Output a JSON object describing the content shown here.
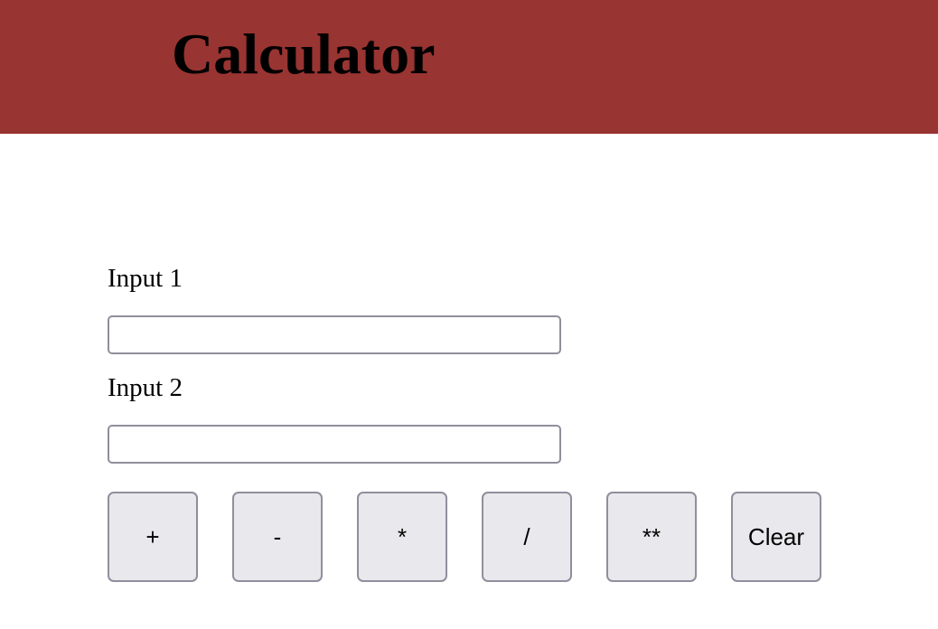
{
  "header": {
    "title": "Calculator",
    "background_color": "#983431"
  },
  "form": {
    "input1": {
      "label": "Input 1",
      "value": "",
      "placeholder": ""
    },
    "input2": {
      "label": "Input 2",
      "value": "",
      "placeholder": ""
    }
  },
  "operations": [
    {
      "label": "+"
    },
    {
      "label": "-"
    },
    {
      "label": "*"
    },
    {
      "label": "/"
    },
    {
      "label": "**"
    },
    {
      "label": "Clear"
    }
  ]
}
